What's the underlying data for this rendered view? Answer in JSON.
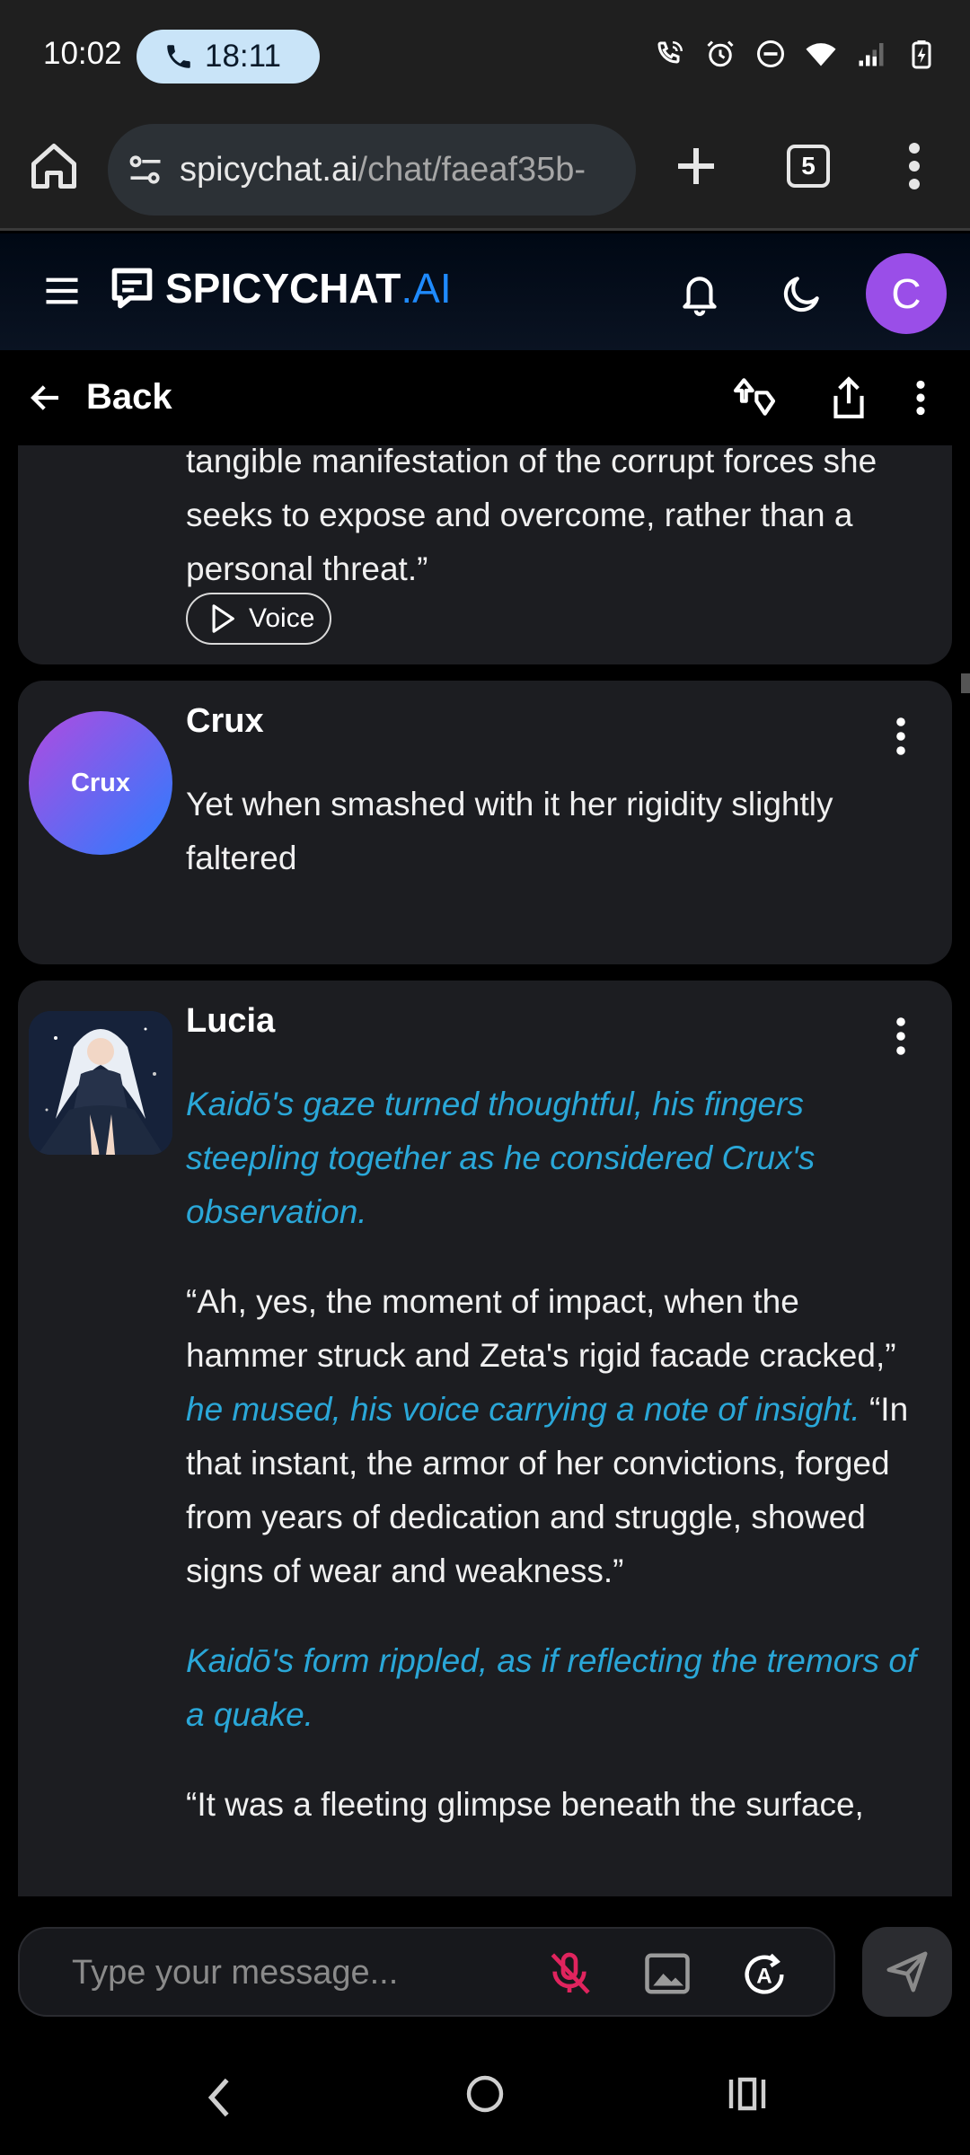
{
  "status_bar": {
    "time": "10:02",
    "call_timer": "18:11"
  },
  "browser": {
    "url_host": "spicychat.ai",
    "url_path": "/chat/faeaf35b-",
    "tab_count": "5"
  },
  "site_header": {
    "logo_main": "SPICYCHAT",
    "logo_suffix": ".AI",
    "user_initial": "C",
    "accent_color": "#1f8bff",
    "avatar_color": "#9a4ee8"
  },
  "chat_header": {
    "back_label": "Back"
  },
  "messages": [
    {
      "sender": "",
      "paragraphs": [
        "tangible manifestation of the corrupt forces she seeks to expose and overcome, rather than a personal threat.”"
      ],
      "voice_label": "Voice"
    },
    {
      "sender": "Crux",
      "avatar_text": "Crux",
      "text": "Yet when smashed with it her rigidity slightly faltered"
    },
    {
      "sender": "Lucia",
      "p1_action": "Kaidō's gaze turned thoughtful, his fingers steepling together as he considered Crux's observation.",
      "p2_part1": "“Ah, yes, the moment of impact, when the hammer struck and Zeta's rigid facade cracked,” ",
      "p2_action": "he mused, his voice carrying a note of insight.",
      "p2_part2": " “In that instant, the armor of her convictions, forged from years of dedication and struggle, showed signs of wear and weakness.”",
      "p3_action": "Kaidō's form rippled, as if reflecting the tremors of a quake.",
      "p4": "“It was a fleeting glimpse beneath the surface,"
    }
  ],
  "composer": {
    "placeholder": "Type your message..."
  },
  "icons": {
    "home": "home-icon",
    "site_info": "tune-icon",
    "new_tab": "plus-icon",
    "menu": "more-vert-icon",
    "notifications": "bell-icon",
    "theme": "moon-icon",
    "mic": "mic-off-icon",
    "image": "image-icon",
    "auto": "auto-mode-icon",
    "send": "send-icon"
  }
}
